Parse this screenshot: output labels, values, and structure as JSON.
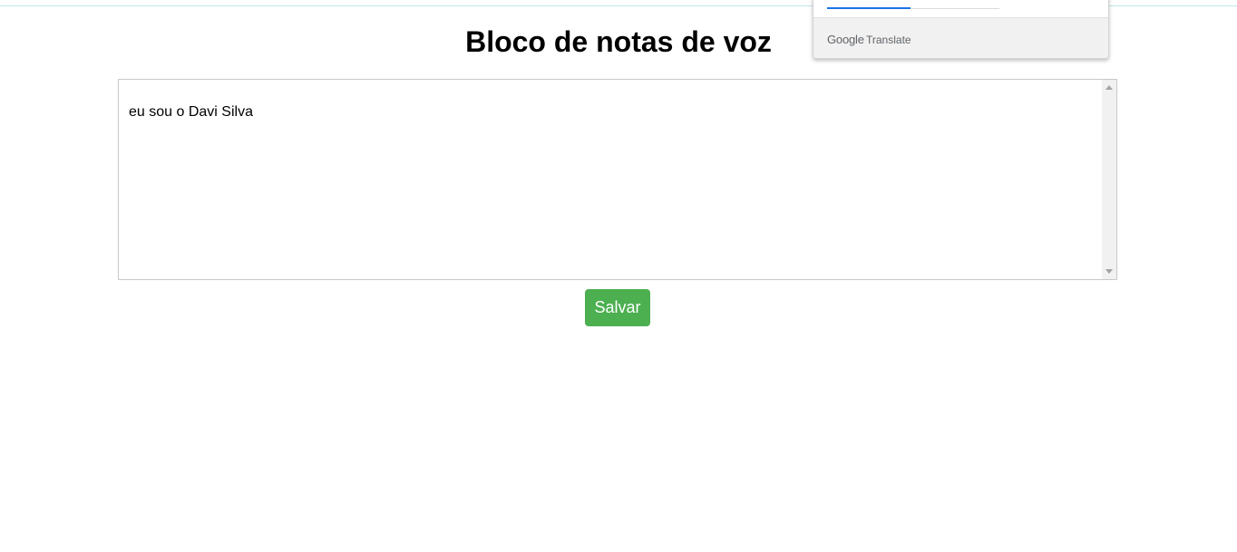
{
  "page": {
    "title": "Bloco de notas de voz"
  },
  "note": {
    "text": "eu sou o Davi Silva"
  },
  "actions": {
    "save_label": "Salvar"
  },
  "translate_popup": {
    "brand": "Google",
    "product": "Translate"
  },
  "colors": {
    "save_button": "#4caf50",
    "active_tab": "#1a73e8"
  }
}
